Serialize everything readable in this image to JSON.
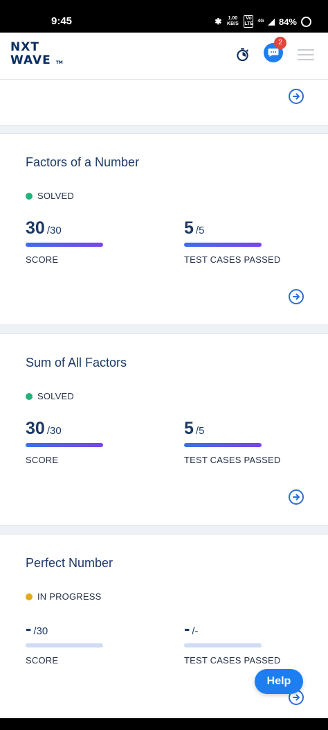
{
  "statusbar": {
    "time": "9:45",
    "network_speed": "1.00 KB/S",
    "volte": "Vo LTE",
    "network": "4G",
    "battery": "84%"
  },
  "header": {
    "logo_line1": "NXT",
    "logo_line2": "WAVE",
    "logo_tm": "TM",
    "chat_badge": "2"
  },
  "cards": [
    {
      "title": "Factors of a Number",
      "status": "SOLVED",
      "status_color": "#1fb47a",
      "score_value": "30",
      "score_total": "/30",
      "score_label": "SCORE",
      "score_progress": 1,
      "tests_value": "5",
      "tests_total": "/5",
      "tests_label": "TEST CASES PASSED",
      "tests_progress": 1
    },
    {
      "title": "Sum of All Factors",
      "status": "SOLVED",
      "status_color": "#1fb47a",
      "score_value": "30",
      "score_total": "/30",
      "score_label": "SCORE",
      "score_progress": 1,
      "tests_value": "5",
      "tests_total": "/5",
      "tests_label": "TEST CASES PASSED",
      "tests_progress": 1
    },
    {
      "title": "Perfect Number",
      "status": "IN PROGRESS",
      "status_color": "#e2ac17",
      "score_value": "-",
      "score_total": "/30",
      "score_label": "SCORE",
      "score_progress": 0,
      "tests_value": "-",
      "tests_total": "/-",
      "tests_label": "TEST CASES PASSED",
      "tests_progress": 0
    }
  ],
  "help_button": "Help",
  "colors": {
    "accent": "#1d7ef2",
    "title": "#1d3a66",
    "progress_start": "#3f6ee8",
    "progress_end": "#7a45e8"
  }
}
